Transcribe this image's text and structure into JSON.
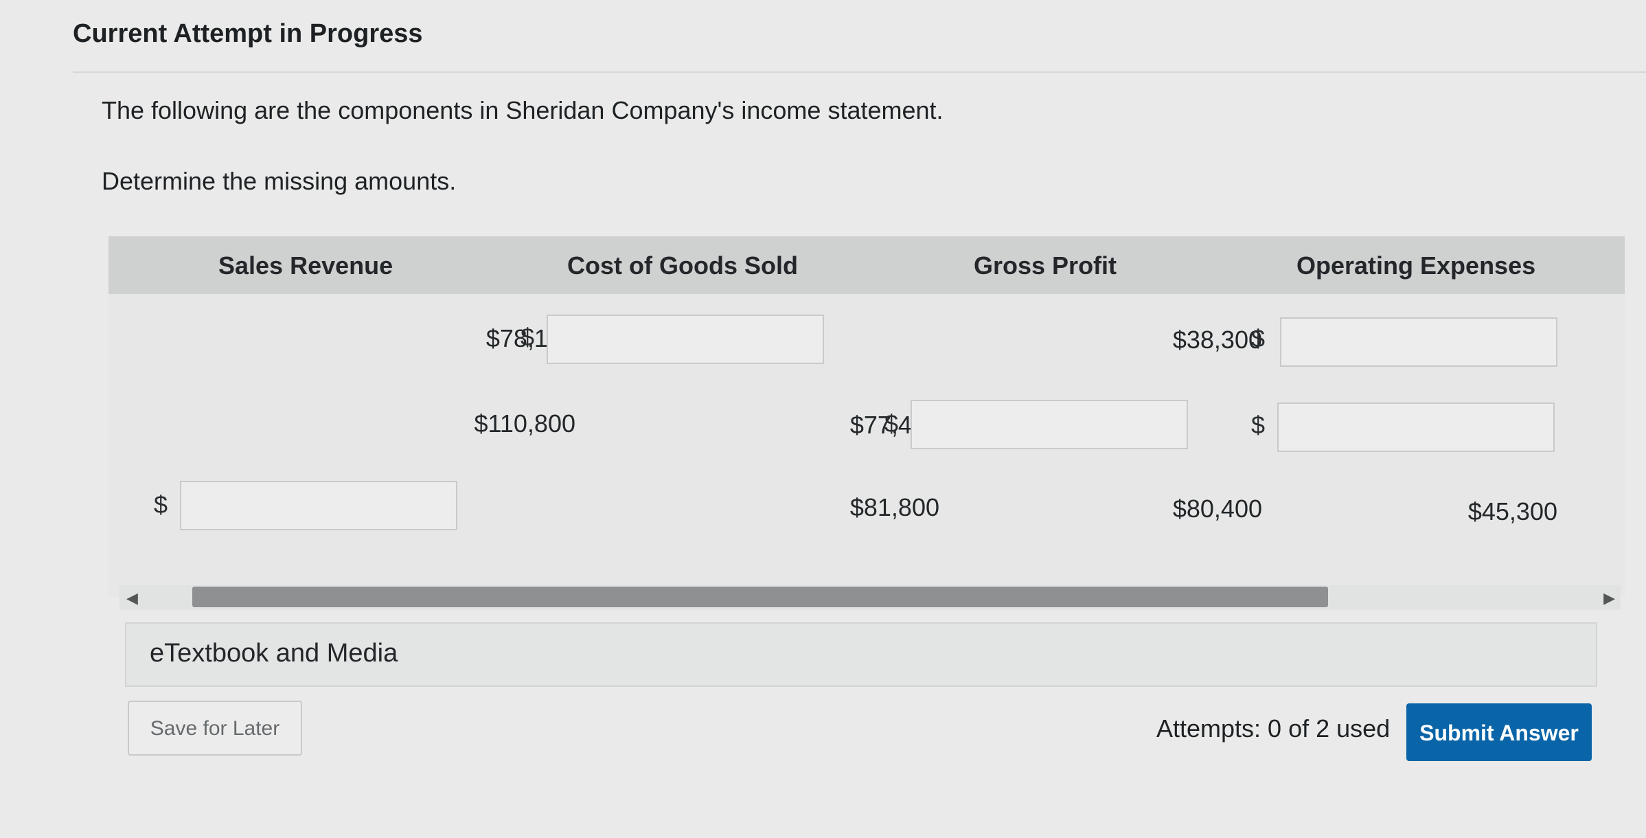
{
  "header": {
    "title": "Current Attempt in Progress"
  },
  "question": {
    "line1": "The following are the components in Sheridan Company's income statement.",
    "line2": "Determine the missing amounts."
  },
  "table": {
    "columns": [
      "Sales Revenue",
      "Cost of Goods Sold",
      "Gross Profit",
      "Operating Expenses"
    ],
    "currency_symbol": "$",
    "rows": [
      {
        "sales_revenue": "$78,100",
        "cost_of_goods_sold": "",
        "gross_profit": "$38,300",
        "operating_expenses": ""
      },
      {
        "sales_revenue": "$110,800",
        "cost_of_goods_sold": "$77,400",
        "gross_profit": "",
        "operating_expenses": ""
      },
      {
        "sales_revenue": "",
        "cost_of_goods_sold": "$81,800",
        "gross_profit": "$80,400",
        "operating_expenses": "$45,300"
      }
    ]
  },
  "media": {
    "label": "eTextbook and Media"
  },
  "footer": {
    "save_label": "Save for Later",
    "attempts_text": "Attempts: 0 of 2 used",
    "submit_label": "Submit Answer"
  },
  "colors": {
    "submit_bg": "#0a65a8",
    "header_row_bg": "#cfd0d0"
  }
}
